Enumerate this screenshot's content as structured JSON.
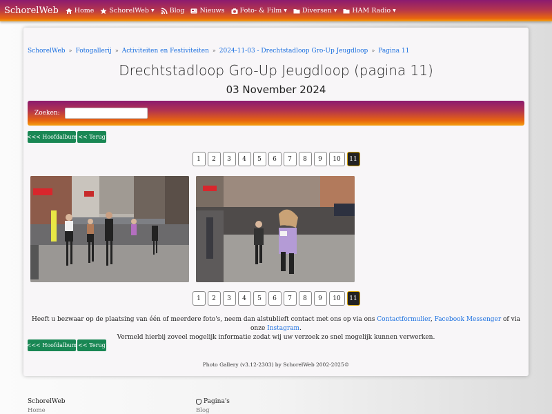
{
  "nav": {
    "brand": "SchorelWeb",
    "items": [
      {
        "label": "Home",
        "icon": "home-icon",
        "dropdown": false
      },
      {
        "label": "SchorelWeb",
        "icon": "star-icon",
        "dropdown": true
      },
      {
        "label": "Blog",
        "icon": "rss-icon",
        "dropdown": false
      },
      {
        "label": "Nieuws",
        "icon": "newspaper-icon",
        "dropdown": false
      },
      {
        "label": "Foto- & Film",
        "icon": "camera-icon",
        "dropdown": true
      },
      {
        "label": "Diversen",
        "icon": "folder-icon",
        "dropdown": true
      },
      {
        "label": "HAM Radio",
        "icon": "folder-icon",
        "dropdown": true
      }
    ]
  },
  "breadcrumb": [
    "SchorelWeb",
    "Fotogallerij",
    "Activiteiten en Festiviteiten",
    "2024-11-03 - Drechtstadloop Gro-Up Jeugdloop",
    "Pagina 11"
  ],
  "page": {
    "title": "Drechtstadloop Gro-Up Jeugdloop (pagina 11)",
    "date": "03 November 2024"
  },
  "search": {
    "label": "Zoeken:",
    "value": "",
    "placeholder": ""
  },
  "buttons": {
    "main_album": "<<< Hoofdalbum",
    "back": "<< Terug"
  },
  "pagination": {
    "pages": [
      "1",
      "2",
      "3",
      "4",
      "5",
      "6",
      "7",
      "8",
      "9",
      "10",
      "11"
    ],
    "current": "11"
  },
  "notice": {
    "text_before": "Heeft u bezwaar op de plaatsing van één of meerdere foto's, neem dan alstublieft contact met ons op via ons ",
    "link_contact": "Contactformulier",
    "sep": ", ",
    "link_messenger": "Facebook Messenger",
    "text_middle": " of via onze ",
    "link_instagram": "Instagram",
    "text_after": ".",
    "line2": "Vermeld hierbij zoveel mogelijk informatie zodat wij uw verzoek zo snel mogelijk kunnen verwerken."
  },
  "credit": "Photo Gallery (v3.12-2303) by SchorelWeb 2002-2025©",
  "footer": {
    "col1_title": "SchorelWeb",
    "col1_item": "Home",
    "col2_title": "Pagina's",
    "col2_item": "Blog"
  },
  "colors": {
    "nav_start": "#8c1b6f",
    "nav_end": "#f4a010",
    "button_green": "#198754",
    "link": "#1a6fe0"
  }
}
